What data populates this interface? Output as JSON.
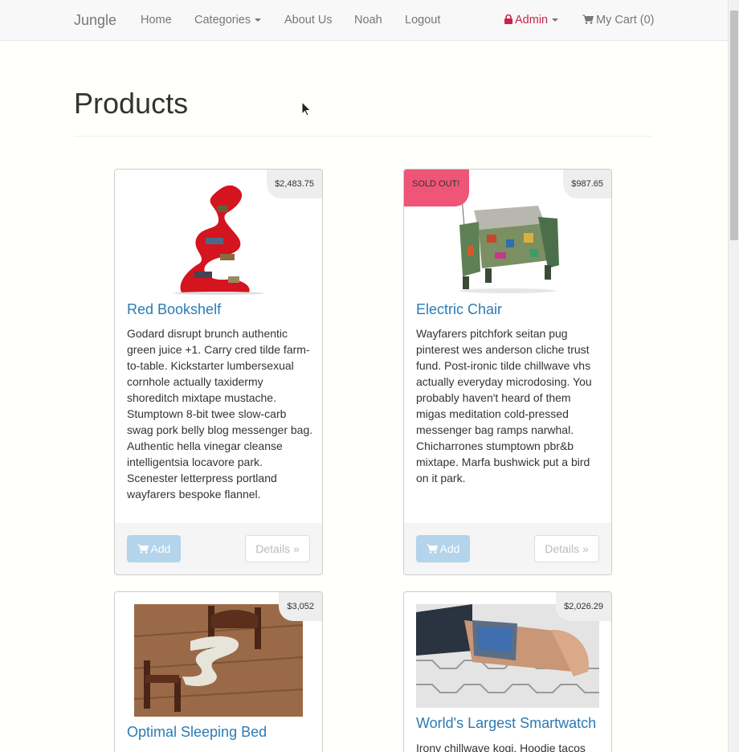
{
  "navbar": {
    "brand": "Jungle",
    "links": [
      "Home",
      "Categories",
      "About Us",
      "Noah",
      "Logout"
    ],
    "admin": "Admin",
    "cart": "My Cart (0)"
  },
  "page": {
    "title": "Products"
  },
  "products": [
    {
      "name": "Red Bookshelf",
      "price": "$2,483.75",
      "description": "Godard disrupt brunch authentic green juice +1. Carry cred tilde farm-to-table. Kickstarter lumbersexual cornhole actually taxidermy shoreditch mixtape mustache. Stumptown 8-bit twee slow-carb swag pork belly blog messenger bag. Authentic hella vinegar cleanse intelligentsia locavore park. Scenester letterpress portland wayfarers bespoke flannel.",
      "add_label": "Add",
      "details_label": "Details »"
    },
    {
      "name": "Electric Chair",
      "price": "$987.65",
      "badge": "SOLD OUT!",
      "description": "Wayfarers pitchfork seitan pug pinterest wes anderson cliche trust fund. Post-ironic tilde chillwave vhs actually everyday microdosing. You probably haven't heard of them migas meditation cold-pressed messenger bag ramps narwhal. Chicharrones stumptown pbr&b mixtape. Marfa bushwick put a bird on it park.",
      "add_label": "Add",
      "details_label": "Details »"
    },
    {
      "name": "Optimal Sleeping Bed",
      "price": "$3,052"
    },
    {
      "name": "World's Largest Smartwatch",
      "price": "$2,026.29",
      "description": "Irony chillwave kogi. Hoodie tacos"
    }
  ]
}
